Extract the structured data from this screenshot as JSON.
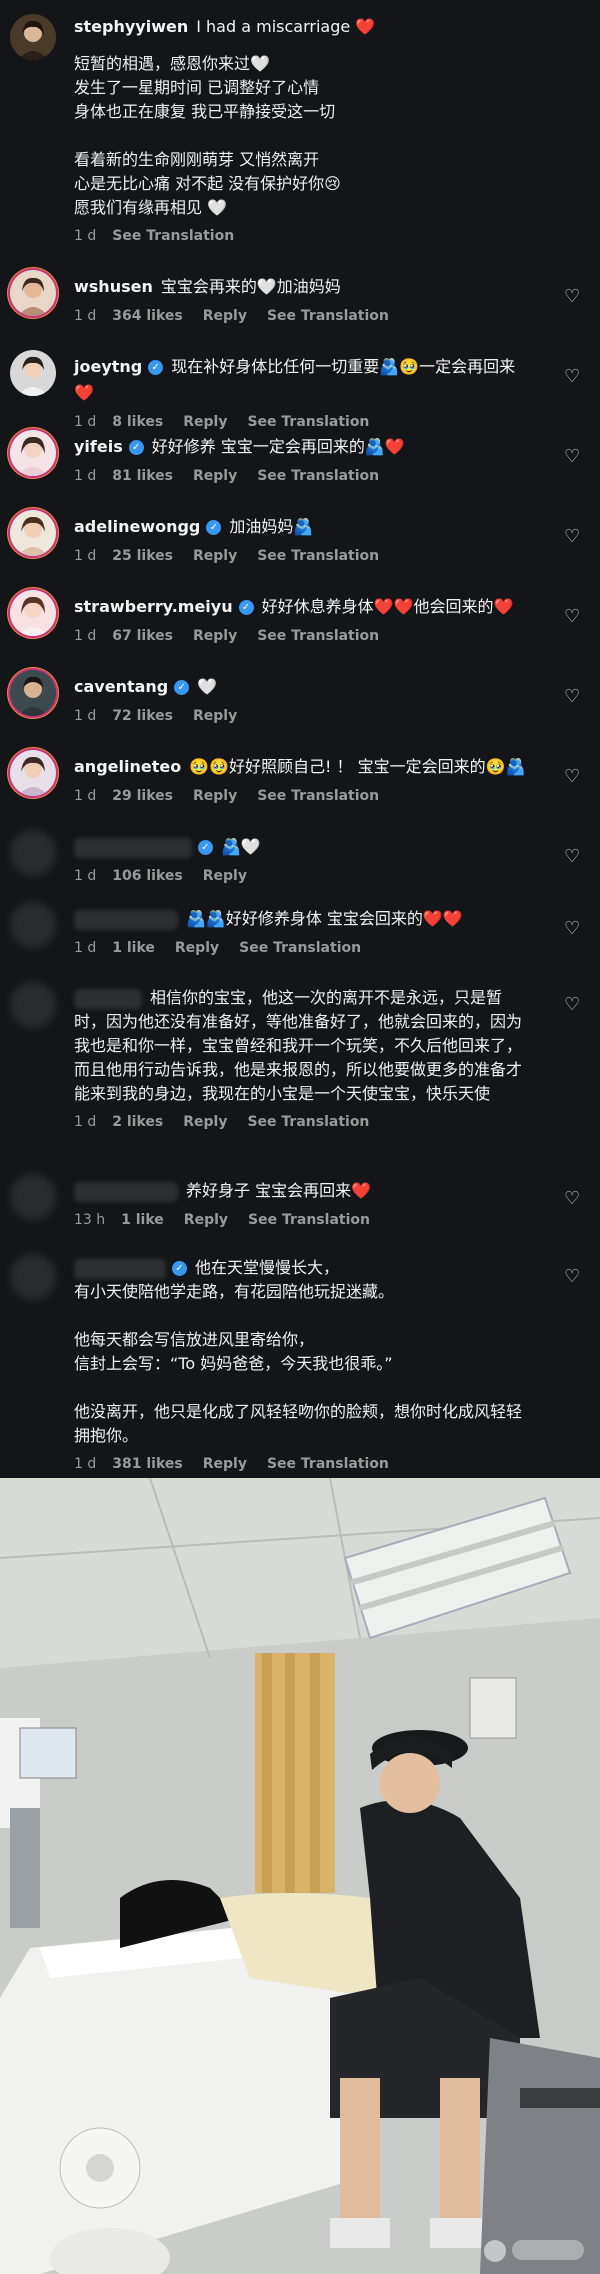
{
  "post": {
    "author": "stephyyiwen",
    "headline": "I had a miscarriage ❤️",
    "body": "短暂的相遇，感恩你来过🤍\n发生了一星期时间 已调整好了心情\n身体也正在康复 我已平静接受这一切\n\n看着新的生命刚刚萌芽 又悄然离开\n心是无比心痛 对不起 没有保护好你😢\n愿我们有缘再相见 🤍",
    "time": "1 d",
    "see_translation": "See Translation"
  },
  "labels": {
    "reply": "Reply",
    "see_translation": "See Translation"
  },
  "comments": [
    {
      "user": "wshusen",
      "verified": false,
      "text": "宝宝会再来的🤍加油妈妈",
      "time": "1 d",
      "likes": "364 likes",
      "translation": true
    },
    {
      "user": "joeytng",
      "verified": true,
      "text": "现在补好身体比任何一切重要🫂🥹一定会再回来❤️",
      "time": "1 d",
      "likes": "8 likes",
      "translation": true
    },
    {
      "user": "yifeis",
      "verified": true,
      "text": "好好修养 宝宝一定会再回来的🫂❤️",
      "time": "1 d",
      "likes": "81 likes",
      "translation": true
    },
    {
      "user": "adelinewongg",
      "verified": true,
      "text": "加油妈妈🫂",
      "time": "1 d",
      "likes": "25 likes",
      "translation": true
    },
    {
      "user": "strawberry.meiyu",
      "verified": true,
      "text": "好好休息养身体❤️❤️他会回来的❤️",
      "time": "1 d",
      "likes": "67 likes",
      "translation": true
    },
    {
      "user": "caventang",
      "verified": true,
      "text": "🤍",
      "time": "1 d",
      "likes": "72 likes",
      "translation": false
    },
    {
      "user": "angelineteo",
      "verified": false,
      "text": "🥹🥹好好照顾自己! ！ 宝宝一定会回来的🥹🫂",
      "time": "1 d",
      "likes": "29 likes",
      "translation": true
    },
    {
      "user": "",
      "verified": true,
      "text": "🫂🤍",
      "time": "1 d",
      "likes": "106 likes",
      "translation": false
    },
    {
      "user": "",
      "verified": false,
      "text": "🫂🫂好好修养身体 宝宝会回来的❤️❤️",
      "time": "1 d",
      "likes": "1 like",
      "translation": true
    },
    {
      "user": "",
      "verified": false,
      "text": "相信你的宝宝，他这一次的离开不是永远，只是暂时，因为他还没有准备好，等他准备好了，他就会回来的，因为我也是和你一样，宝宝曾经和我开一个玩笑，不久后他回来了，而且他用行动告诉我，他是来报恩的，所以他要做更多的准备才能来到我的身边，我现在的小宝是一个天使宝宝，快乐天使",
      "time": "1 d",
      "likes": "2 likes",
      "translation": true
    },
    {
      "user": "",
      "verified": false,
      "text": "养好身子 宝宝会再回来❤️",
      "time": "13 h",
      "likes": "1 like",
      "translation": true
    },
    {
      "user": "",
      "verified": true,
      "text": "他在天堂慢慢长大，\n有小天使陪他学走路，有花园陪他玩捉迷藏。\n\n他每天都会写信放进风里寄给你，\n信封上会写：“To 妈妈爸爸，今天我也很乖。”\n\n他没离开，他只是化成了风轻轻吻你的脸颊，想你时化成风轻轻拥抱你。",
      "time": "1 d",
      "likes": "381 likes",
      "translation": true
    }
  ],
  "icons": {
    "like": "heart-outline-icon",
    "play": "play-icon",
    "watermark": "watermark-logo"
  },
  "colors": {
    "background": "#131518",
    "verified": "#3897f0",
    "muted": "#9a9a9a"
  }
}
